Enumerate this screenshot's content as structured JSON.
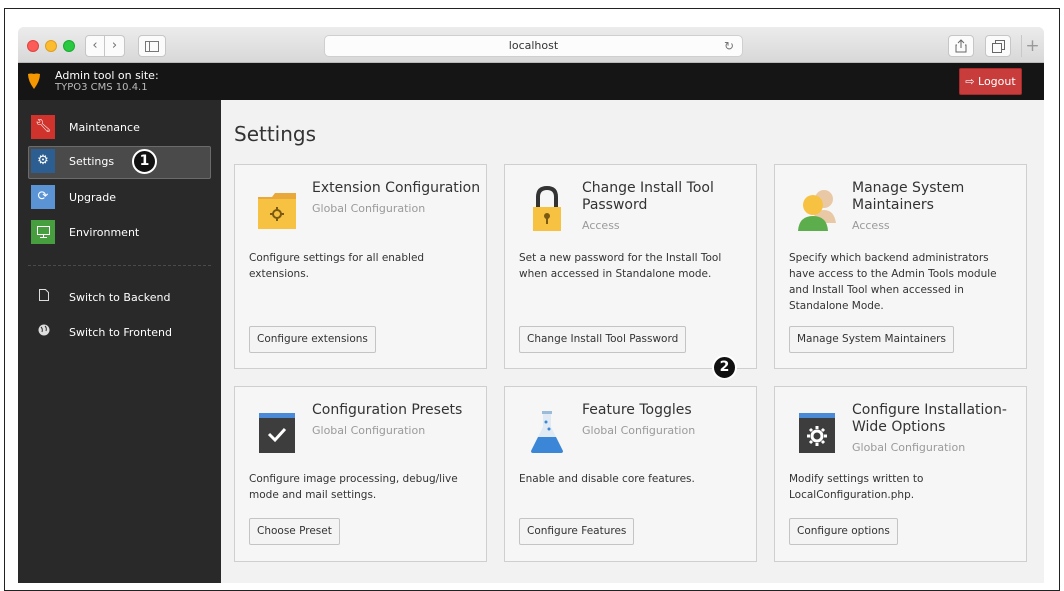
{
  "browser": {
    "url": "localhost",
    "nav_back": "‹",
    "nav_forward": "›"
  },
  "header": {
    "site_line1": "Admin tool on site:",
    "site_line2": "TYPO3 CMS 10.4.1",
    "logout_label": "Logout",
    "logo_color": "#f49700",
    "logout_color": "#c83c3c"
  },
  "sidebar": {
    "items": [
      {
        "label": "Maintenance",
        "icon": "wrench-icon",
        "color": "#d0332c"
      },
      {
        "label": "Settings",
        "icon": "gear-icon",
        "color": "#2c5e92"
      },
      {
        "label": "Upgrade",
        "icon": "refresh-icon",
        "color": "#5a94d5"
      },
      {
        "label": "Environment",
        "icon": "monitor-icon",
        "color": "#479e3e"
      }
    ],
    "links": [
      {
        "label": "Switch to Backend",
        "icon": "document-icon"
      },
      {
        "label": "Switch to Frontend",
        "icon": "globe-icon"
      }
    ]
  },
  "callouts": [
    "1",
    "2"
  ],
  "main": {
    "title": "Settings",
    "cards": [
      {
        "title": "Extension Configuration",
        "subtitle": "Global Configuration",
        "description": "Configure settings for all enabled extensions.",
        "button": "Configure extensions",
        "icon": "folder-gear-icon"
      },
      {
        "title": "Change Install Tool Password",
        "subtitle": "Access",
        "description": "Set a new password for the Install Tool when accessed in Standalone mode.",
        "button": "Change Install Tool Password",
        "icon": "padlock-icon"
      },
      {
        "title": "Manage System Maintainers",
        "subtitle": "Access",
        "description": "Specify which backend administrators have access to the Admin Tools module and Install Tool when accessed in Standalone Mode.",
        "button": "Manage System Maintainers",
        "icon": "users-icon"
      },
      {
        "title": "Configuration Presets",
        "subtitle": "Global Configuration",
        "description": "Configure image processing, debug/live mode and mail settings.",
        "button": "Choose Preset",
        "icon": "checkmark-box-icon"
      },
      {
        "title": "Feature Toggles",
        "subtitle": "Global Configuration",
        "description": "Enable and disable core features.",
        "button": "Configure Features",
        "icon": "flask-icon"
      },
      {
        "title": "Configure Installation-Wide Options",
        "subtitle": "Global Configuration",
        "description": "Modify settings written to LocalConfiguration.php.",
        "button": "Configure options",
        "icon": "gear-box-icon"
      }
    ]
  }
}
